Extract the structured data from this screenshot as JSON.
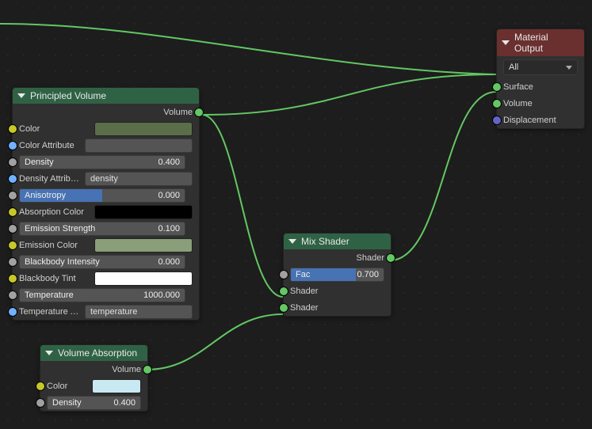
{
  "principled": {
    "title": "Principled Volume",
    "out_volume": "Volume",
    "rows": {
      "color": {
        "label": "Color",
        "swatch": "#5a6e4a"
      },
      "color_attr": {
        "label": "Color Attribute",
        "value": ""
      },
      "density": {
        "label": "Density",
        "value": "0.400",
        "fill": 0
      },
      "density_attr": {
        "label": "Density Attribu..",
        "value": "density"
      },
      "anisotropy": {
        "label": "Anisotropy",
        "value": "0.000",
        "fill": 50
      },
      "absorption": {
        "label": "Absorption Color",
        "swatch": "#000000"
      },
      "emission_strength": {
        "label": "Emission Strength",
        "value": "0.100",
        "fill": 0
      },
      "emission_color": {
        "label": "Emission Color",
        "swatch": "#8a9e7a"
      },
      "blackbody_intensity": {
        "label": "Blackbody Intensity",
        "value": "0.000",
        "fill": 0
      },
      "blackbody_tint": {
        "label": "Blackbody Tint",
        "swatch": "#ffffff"
      },
      "temperature": {
        "label": "Temperature",
        "value": "1000.000",
        "fill": 0
      },
      "temperature_attr": {
        "label": "Temperature A..",
        "value": "temperature"
      }
    }
  },
  "mix": {
    "title": "Mix Shader",
    "out_shader": "Shader",
    "fac": {
      "label": "Fac",
      "value": "0.700",
      "fill": 70
    },
    "in1": "Shader",
    "in2": "Shader"
  },
  "vabs": {
    "title": "Volume Absorption",
    "out_volume": "Volume",
    "color": {
      "label": "Color",
      "swatch": "#c9e9f2"
    },
    "density": {
      "label": "Density",
      "value": "0.400"
    }
  },
  "output": {
    "title": "Material Output",
    "dropdown": "All",
    "rows": {
      "surface": "Surface",
      "volume": "Volume",
      "displacement": "Displacement"
    }
  }
}
